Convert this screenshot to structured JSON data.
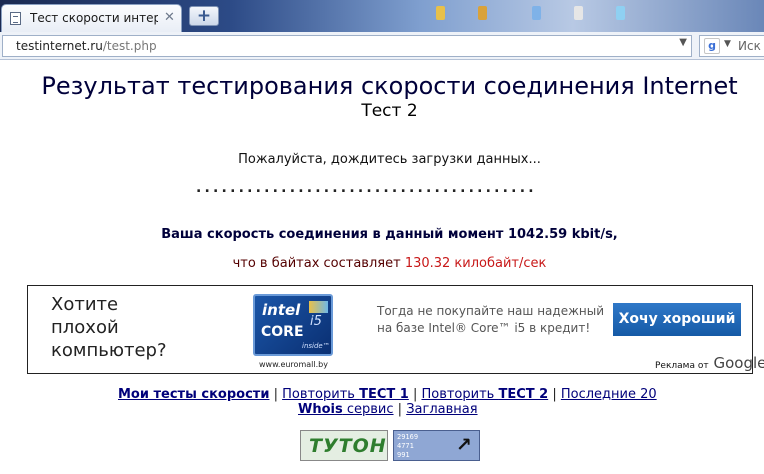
{
  "browser": {
    "tab_title": "Тест скорости интерн…",
    "tab_close": "✕",
    "newtab_label": "+",
    "url_host": "testinternet.ru",
    "url_path": "/test.php",
    "search_text": "Иск",
    "icons": {
      "tab": "page-icon",
      "search_engine": "google-icon"
    }
  },
  "page": {
    "title": "Результат тестирования скорости соединения Internet",
    "subtitle": "Тест 2",
    "wait_text": "Пожалуйста, дождитесь загрузки данных...",
    "dots": "........................................",
    "speed_text": "Ваша скорость соединения в данный момент 1042.59 kbit/s,",
    "bytes_prefix": "что в байтах составляет ",
    "bytes_value": "130.32 килобайт/сек"
  },
  "ad": {
    "headline": "Хотите\nплохой\nкомпьютер?",
    "intel_top": "intel",
    "intel_model": "i5",
    "intel_core": "CORE",
    "intel_inside": "inside™",
    "site": "www.euromall.by",
    "offer": "Тогда не покупайте наш надежный\nна базе Intel® Core™ i5 в кредит!",
    "button": "Хочу хороший ►",
    "ads_by": "Реклама от",
    "ads_brand": "Google"
  },
  "links": {
    "my_tests": "Мои тесты скорости",
    "repeat1_prefix": "Повторить ",
    "repeat1_bold": "ТЕСТ 1",
    "repeat2_prefix": "Повторить ",
    "repeat2_bold": "ТЕСТ 2",
    "last20": "Последние 20",
    "whois_bold": "Whois",
    "whois_rest": " сервис",
    "main": "Заглавная",
    "sep": " | "
  },
  "counters": {
    "tuton": "ТУТОН",
    "stat1": "29169",
    "stat2": "4771",
    "stat3": "991",
    "arrow": "↗"
  },
  "colors": {
    "title": "#00003a",
    "highlight": "#c81818",
    "link": "#00007a",
    "ad_button": "#1a64b4"
  }
}
